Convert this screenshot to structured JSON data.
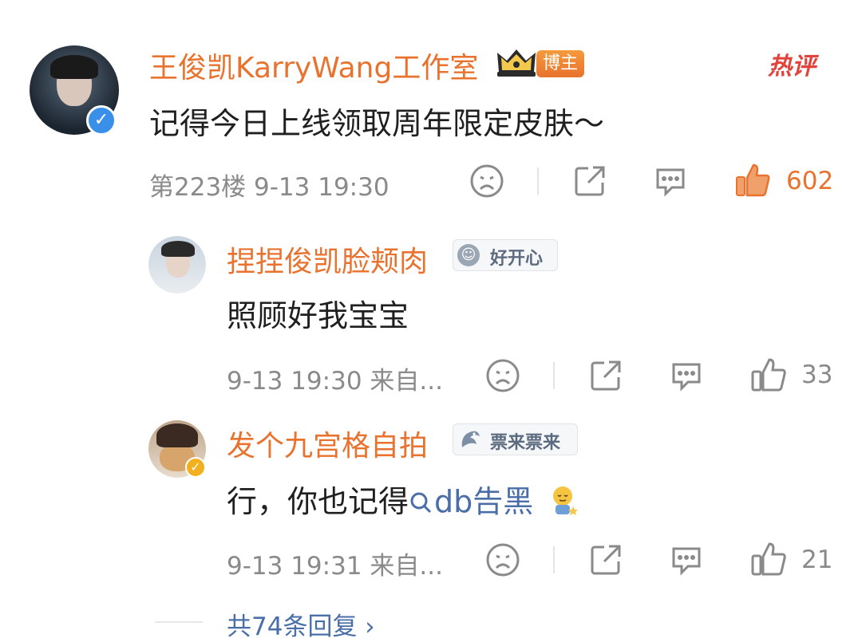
{
  "colors": {
    "accent": "#e8722e",
    "meta": "#8a8a8a",
    "link": "#4a6ea8",
    "verified": "#3a8fe8"
  },
  "hot_label": "热评",
  "main_comment": {
    "author": "王俊凯KarryWang工作室",
    "badge": "博主",
    "text": "记得今日上线领取周年限定皮肤～",
    "meta": "第223楼  9-13 19:30",
    "likes": "602",
    "verified": true
  },
  "replies": [
    {
      "author": "捏捏俊凯脸颊肉",
      "badge": "好开心",
      "text": "照顾好我宝宝",
      "meta": "9-13 19:30  来自...",
      "likes": "33"
    },
    {
      "author": "发个九宫格自拍",
      "badge": "票来票来",
      "text_prefix": "行，你也记得",
      "link_text": "db告黑",
      "emoji_icon": "face-emoji-icon",
      "meta": "9-13 19:31  来自...",
      "likes": "21",
      "verified": true
    }
  ],
  "more_replies": "共74条回复 ›"
}
